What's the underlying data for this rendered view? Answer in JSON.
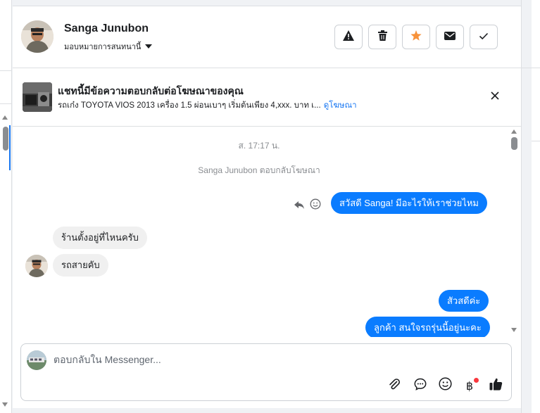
{
  "header": {
    "contact_name": "Sanga Junubon",
    "assign_label": "มอบหมายการสนทนานี้"
  },
  "actions": {
    "spam_icon": "warning-icon",
    "delete_icon": "trash-icon",
    "star_icon": "star-icon",
    "mail_icon": "envelope-icon",
    "done_icon": "check-icon",
    "star_color": "#f7923b"
  },
  "ad": {
    "title": "แชทนี้มีข้อความตอบกลับต่อโฆษณาของคุณ",
    "description": "รถเก๋ง TOYOTA VIOS 2013 เครื่อง 1.5 ผ่อนเบาๆ เริ่มต้นเพียง 4,xxx. บาท เ...",
    "link_label": "ดูโฆษณา"
  },
  "messages": {
    "timestamp": "ส. 17:17 น.",
    "reply_notice": "Sanga Junubon ตอบกลับโฆษณา",
    "outgoing_1": "สวัสดี Sanga! มีอะไรให้เราช่วยไหม",
    "incoming_1": "ร้านตั้งอยู่ที่ไหนครับ",
    "incoming_2": "รถสายคับ",
    "outgoing_2": "สัวสดีค่ะ",
    "outgoing_3": "ลูกค้า สนใจรถรุ่นนี้อยู่นะคะ",
    "bubble_color": "#0a7cff"
  },
  "composer": {
    "placeholder": "ตอบกลับใน Messenger...",
    "currency_symbol": "฿",
    "tools": [
      "paperclip-icon",
      "chat-bubble-icon",
      "emoji-icon",
      "baht-icon",
      "thumbs-up-icon"
    ]
  }
}
